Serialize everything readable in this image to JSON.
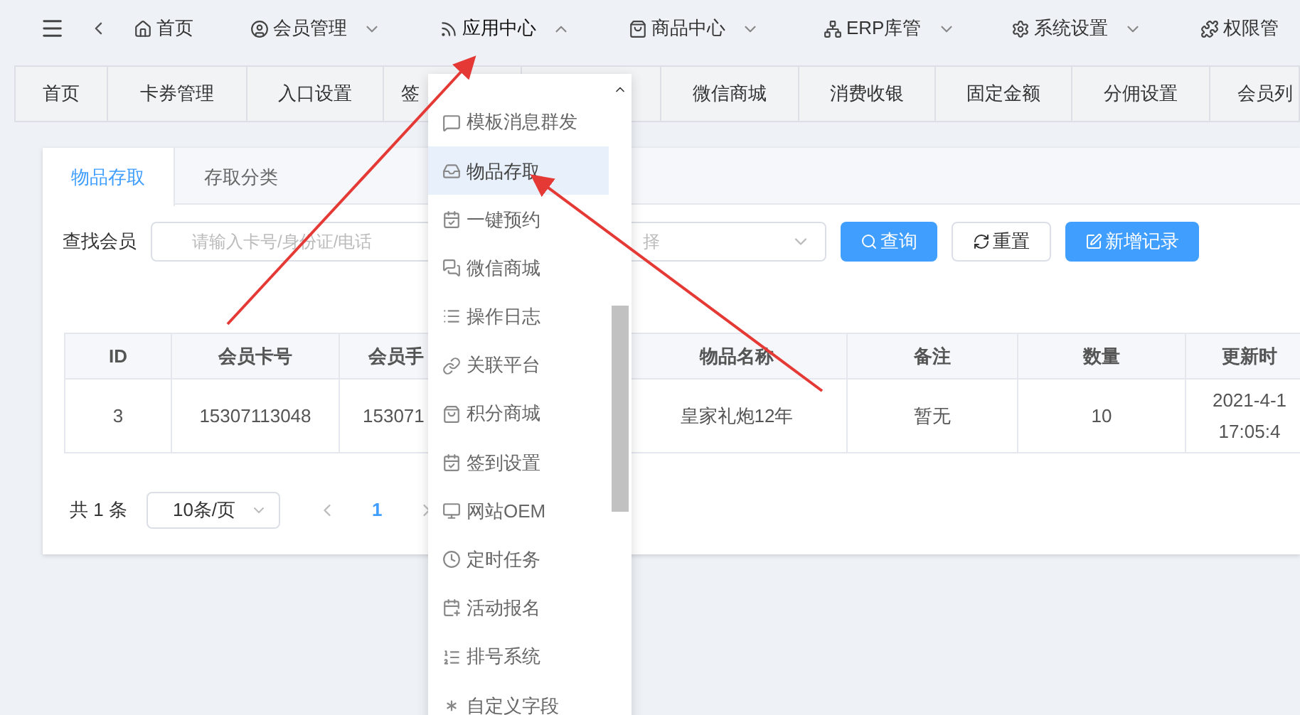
{
  "top_nav": {
    "items": [
      {
        "label": "首页",
        "has_caret": false,
        "expanded": false
      },
      {
        "label": "会员管理",
        "has_caret": true,
        "expanded": false
      },
      {
        "label": "应用中心",
        "has_caret": true,
        "expanded": true
      },
      {
        "label": "商品中心",
        "has_caret": true,
        "expanded": false
      },
      {
        "label": "ERP库管",
        "has_caret": true,
        "expanded": false
      },
      {
        "label": "系统设置",
        "has_caret": true,
        "expanded": false
      },
      {
        "label": "权限管",
        "has_caret": false,
        "expanded": false
      }
    ]
  },
  "page_tabs": [
    {
      "label": "首页"
    },
    {
      "label": "卡券管理"
    },
    {
      "label": "入口设置"
    },
    {
      "label": "签"
    },
    {
      "label": "微信商城"
    },
    {
      "label": "消费收银"
    },
    {
      "label": "固定金额"
    },
    {
      "label": "分佣设置"
    },
    {
      "label": "会员列"
    }
  ],
  "card": {
    "tabs": [
      {
        "label": "物品存取",
        "selected": true
      },
      {
        "label": "存取分类",
        "selected": false
      }
    ],
    "search": {
      "label": "查找会员",
      "placeholder": "请输入卡号/身份证/电话",
      "select_placeholder": "择"
    },
    "buttons": [
      {
        "label": "查询",
        "kind": "primary"
      },
      {
        "label": "重置",
        "kind": "default"
      },
      {
        "label": "新增记录",
        "kind": "primary"
      }
    ],
    "table": {
      "columns": [
        "ID",
        "会员卡号",
        "会员手",
        "物品名称",
        "备注",
        "数量",
        "更新时"
      ],
      "rows": [
        [
          "3",
          "15307113048",
          "153071",
          "皇家礼炮12年",
          "暂无",
          "10",
          "2021-4-1\n17:05:4"
        ]
      ]
    },
    "pagination": {
      "total": "共 1 条",
      "page_size": "10条/页",
      "pages": [
        {
          "label": "1",
          "selected": true
        }
      ]
    }
  },
  "dropdown": {
    "items": [
      {
        "label": "模板消息群发",
        "selected": false
      },
      {
        "label": "物品存取",
        "selected": true
      },
      {
        "label": "一键预约",
        "selected": false
      },
      {
        "label": "微信商城",
        "selected": false
      },
      {
        "label": "操作日志",
        "selected": false
      },
      {
        "label": "关联平台",
        "selected": false
      },
      {
        "label": "积分商城",
        "selected": false
      },
      {
        "label": "签到设置",
        "selected": false
      },
      {
        "label": "网站OEM",
        "selected": false
      },
      {
        "label": "定时任务",
        "selected": false
      },
      {
        "label": "活动报名",
        "selected": false
      },
      {
        "label": "排号系统",
        "selected": false
      },
      {
        "label": "自定义字段",
        "selected": false
      }
    ]
  }
}
